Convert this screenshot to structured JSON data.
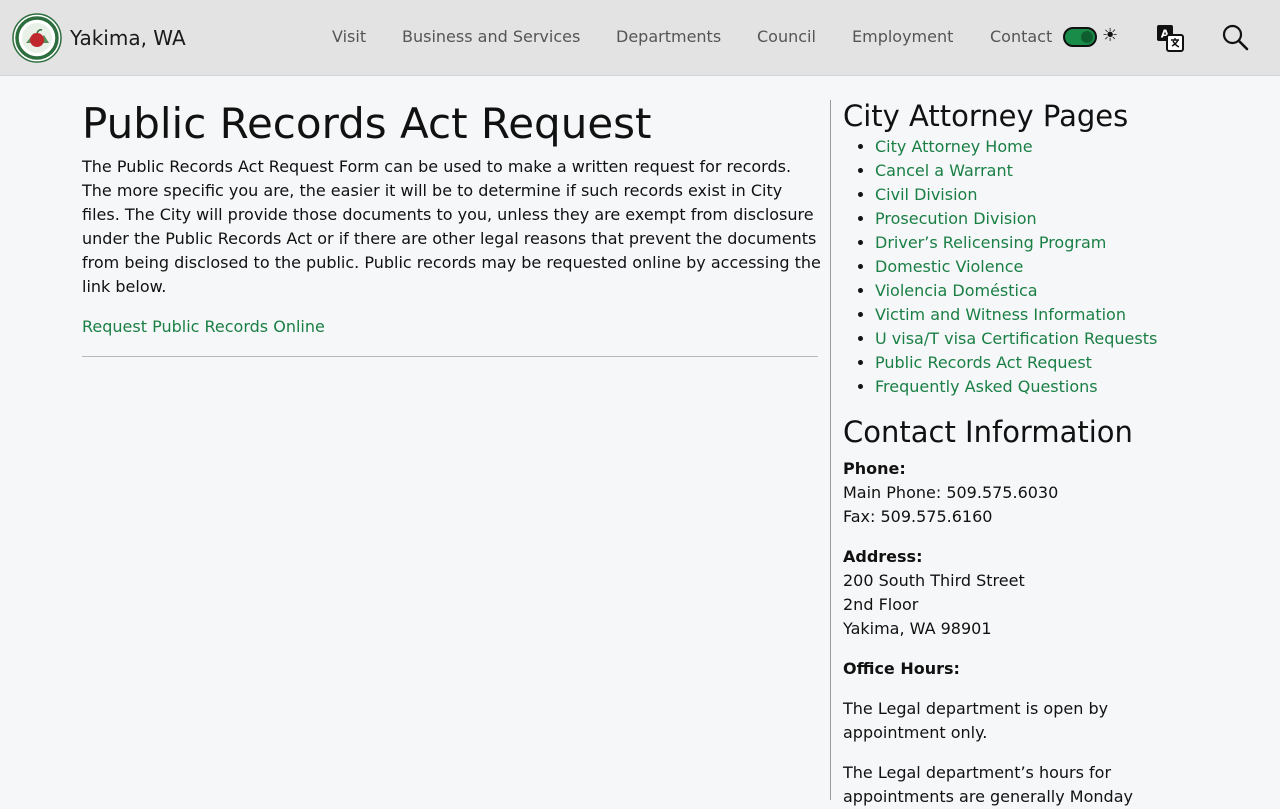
{
  "header": {
    "site_name": "Yakima, WA",
    "logo_icon": "city-seal-icon",
    "nav": [
      {
        "label": "Visit"
      },
      {
        "label": "Business and Services"
      },
      {
        "label": "Departments"
      },
      {
        "label": "Council"
      },
      {
        "label": "Employment"
      },
      {
        "label": "Contact"
      }
    ],
    "theme_toggle_state": "on",
    "sun_glyph": "☀",
    "translate_icon": "translate-icon",
    "search_icon": "search-icon"
  },
  "main": {
    "title": "Public Records Act Request",
    "intro": "The Public Records Act Request Form can be used to make a written request for records. The more specific you are, the easier it will be to determine if such records exist in City files. The City will provide those documents to you, unless they are exempt from disclosure under the Public Records Act or if there are other legal reasons that prevent the documents from being disclosed to the public. Public records may be requested online by accessing the link below.",
    "request_link": "Request Public Records Online"
  },
  "sidebar": {
    "pages_heading": "City Attorney Pages",
    "pages": [
      "City Attorney Home",
      "Cancel a Warrant",
      "Civil Division",
      "Prosecution Division",
      "Driver’s Relicensing Program",
      "Domestic Violence",
      "Violencia Doméstica",
      "Victim and Witness Information",
      "U visa/T visa Certification Requests",
      "Public Records Act Request",
      "Frequently Asked Questions"
    ],
    "contact_heading": "Contact Information",
    "phone_label": "Phone:",
    "main_phone": "Main Phone: 509.575.6030",
    "fax": "Fax: 509.575.6160",
    "address_label": "Address:",
    "address_line1": "200 South Third Street",
    "address_line2": "2nd Floor",
    "address_line3": "Yakima, WA 98901",
    "hours_label": "Office Hours:",
    "hours_text1": "The Legal department is open by appointment only.",
    "hours_text2": "The Legal department’s hours for appointments are generally Monday"
  },
  "colors": {
    "link": "#1a7f45",
    "header_bg": "#e3e3e3",
    "page_bg": "#f6f7f8"
  }
}
